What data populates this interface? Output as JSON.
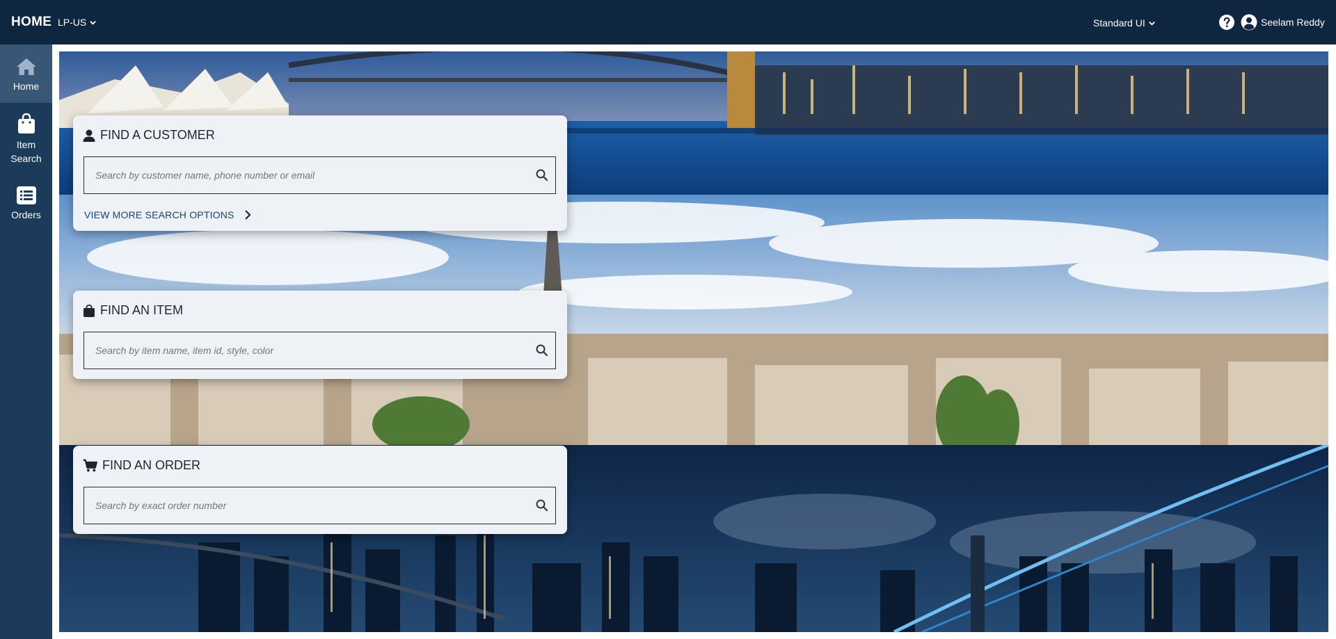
{
  "header": {
    "title": "HOME",
    "locale": "LP-US",
    "ui_mode": "Standard UI",
    "user_name": "Seelam Reddy",
    "colors": {
      "background": "#0f2640",
      "text": "#ffffff"
    }
  },
  "sidebar": {
    "items": [
      {
        "label": "Home",
        "icon": "home-icon",
        "active": true
      },
      {
        "label": "Item Search",
        "icon": "shopping-bag-icon",
        "active": false
      },
      {
        "label": "Orders",
        "icon": "list-icon",
        "active": false
      }
    ],
    "colors": {
      "background": "#1c3a5a",
      "active": "#385777"
    }
  },
  "cards": {
    "customer": {
      "title": "FIND A CUSTOMER",
      "icon": "user-icon",
      "placeholder": "Search by customer name, phone number or email",
      "more_link": "VIEW MORE SEARCH OPTIONS"
    },
    "item": {
      "title": "FIND AN ITEM",
      "icon": "shopping-bag-icon",
      "placeholder": "Search by item name, item id, style, color"
    },
    "order": {
      "title": "FIND AN ORDER",
      "icon": "cart-icon",
      "placeholder": "Search by exact order number"
    }
  }
}
